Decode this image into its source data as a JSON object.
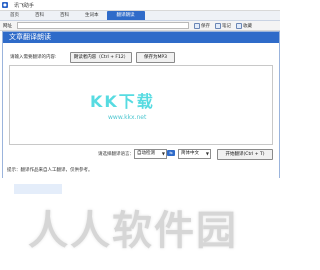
{
  "app": {
    "title": "讯飞助手"
  },
  "tabs": [
    {
      "label": "首页",
      "active": false
    },
    {
      "label": "百科",
      "active": false
    },
    {
      "label": "百科",
      "active": false
    },
    {
      "label": "生词本",
      "active": false
    },
    {
      "label": "翻译朗读",
      "active": true
    }
  ],
  "address": {
    "label": "网址",
    "value": ""
  },
  "toolbar": [
    {
      "label": "保存",
      "icon": "save-icon"
    },
    {
      "label": "笔记",
      "icon": "note-icon"
    },
    {
      "label": "收藏",
      "icon": "star-icon"
    }
  ],
  "panel": {
    "title": "文章翻译朗读",
    "prompt": "请输入需要翻译的内容:",
    "read_button": "朗读者内容（Ctrl + F12）",
    "mp3_button": "保存为MP3",
    "lang_label": "请选择翻译语言：",
    "source_lang": "自动检测",
    "swap_label": "⇆",
    "target_lang": "简体中文",
    "translate_button": "开始翻译(Ctrl + T)",
    "footnote": "提示：翻译作品来自人工翻译，仅供参考。"
  },
  "watermarks": {
    "mid": "KK下载",
    "url": "www.kkx.net",
    "big": "人人软件园"
  },
  "colors": {
    "accent": "#2f6bc9",
    "watermark": "#20d0d8"
  }
}
